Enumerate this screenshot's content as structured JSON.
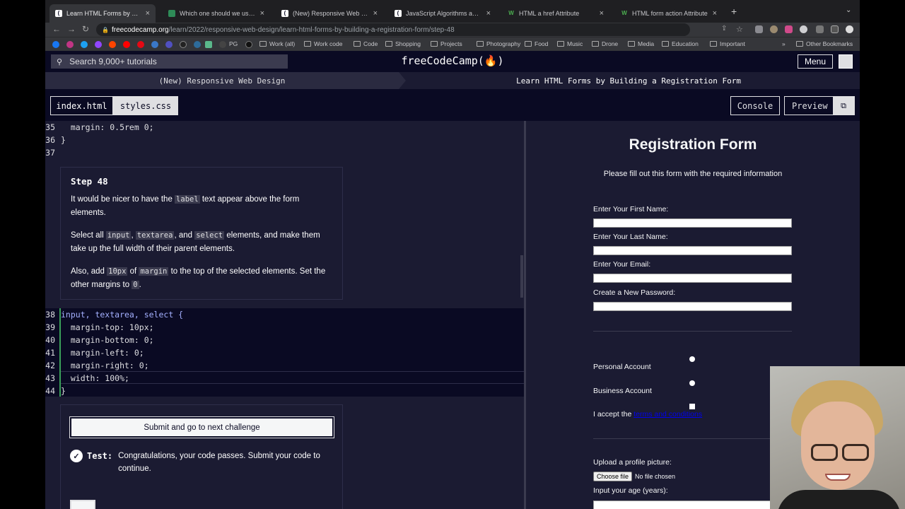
{
  "browser": {
    "tabs": [
      {
        "label": "Learn HTML Forms by Building",
        "active": true
      },
      {
        "label": "Which one should we use 'bor"
      },
      {
        "label": "(New) Responsive Web Desig"
      },
      {
        "label": "JavaScript Algorithms and Dat"
      },
      {
        "label": "HTML a href Attribute"
      },
      {
        "label": "HTML form action Attribute"
      }
    ],
    "url_host": "freecodecamp.org",
    "url_path": "/learn/2022/responsive-web-design/learn-html-forms-by-building-a-registration-form/step-48",
    "bookmarks": [
      "Work (all)",
      "Work code",
      "Code",
      "Shopping",
      "Projects",
      "Photography",
      "Food",
      "Music",
      "Drone",
      "Media",
      "Education",
      "Important"
    ],
    "bookmark_pg": "PG",
    "other_bookmarks": "Other Bookmarks"
  },
  "fcc": {
    "search_placeholder": "Search 9,000+ tutorials",
    "logo": "freeCodeCamp(🔥)",
    "menu": "Menu",
    "crumb_course": "(New) Responsive Web Design",
    "crumb_project": "Learn HTML Forms by Building a Registration Form"
  },
  "editor": {
    "tab_index": "index.html",
    "tab_styles": "styles.css",
    "console": "Console",
    "preview": "Preview",
    "top_lines": [
      {
        "n": "35",
        "code": "  margin: 0.5rem 0;"
      },
      {
        "n": "36",
        "code": "}"
      },
      {
        "n": "37",
        "code": ""
      }
    ],
    "edit_lines": [
      {
        "n": "38",
        "code": "input, textarea, select {"
      },
      {
        "n": "39",
        "code": "  margin-top: 10px;"
      },
      {
        "n": "40",
        "code": "  margin-bottom: 0;"
      },
      {
        "n": "41",
        "code": "  margin-left: 0;"
      },
      {
        "n": "42",
        "code": "  margin-right: 0;"
      },
      {
        "n": "43",
        "code": "  width: 100%;"
      },
      {
        "n": "44",
        "code": "}"
      }
    ]
  },
  "step": {
    "title": "Step 48",
    "p1_a": "It would be nicer to have the ",
    "p1_code": "label",
    "p1_b": " text appear above the form elements.",
    "p2_a": "Select all ",
    "p2_c1": "input",
    "p2_sep1": ", ",
    "p2_c2": "textarea",
    "p2_sep2": ", and ",
    "p2_c3": "select",
    "p2_b": " elements, and make them take up the full width of their parent elements.",
    "p3_a": "Also, add ",
    "p3_c1": "10px",
    "p3_b": " of ",
    "p3_c2": "margin",
    "p3_c": " to the top of the selected elements. Set the other margins to ",
    "p3_c3": "0",
    "p3_d": "."
  },
  "submit_label": "Submit and go to next challenge",
  "test": {
    "label": "Test:",
    "message": "Congratulations, your code passes. Submit your code to continue."
  },
  "preview_page": {
    "title": "Registration Form",
    "subtitle": "Please fill out this form with the required information",
    "first_name": "Enter Your First Name:",
    "last_name": "Enter Your Last Name:",
    "email": "Enter Your Email:",
    "password": "Create a New Password:",
    "personal": "Personal Account",
    "business": "Business Account",
    "accept": "I accept the ",
    "terms": "terms and conditions",
    "upload": "Upload a profile picture:",
    "choose_file": "Choose file",
    "no_file": "No file chosen",
    "age": "Input your age (years):"
  }
}
